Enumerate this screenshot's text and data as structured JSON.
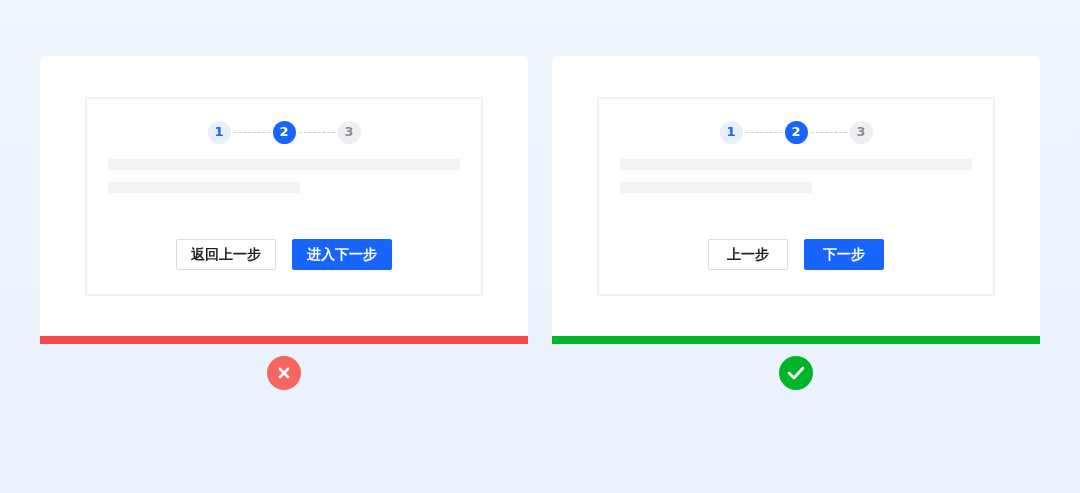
{
  "panels": [
    {
      "correct": false,
      "steps": [
        {
          "label": "1",
          "completed": true,
          "selected": false
        },
        {
          "label": "2",
          "completed": false,
          "selected": true
        },
        {
          "label": "3",
          "completed": false,
          "selected": false
        }
      ],
      "buttons": [
        {
          "label": "返回上一步",
          "kind": "secondary"
        },
        {
          "label": "进入下一步",
          "kind": "primary"
        }
      ]
    },
    {
      "correct": true,
      "steps": [
        {
          "label": "1",
          "completed": true,
          "selected": false
        },
        {
          "label": "2",
          "completed": false,
          "selected": true
        },
        {
          "label": "3",
          "completed": false,
          "selected": false
        }
      ],
      "buttons": [
        {
          "label": "上一步",
          "kind": "secondary"
        },
        {
          "label": "下一步",
          "kind": "primary"
        }
      ]
    }
  ]
}
